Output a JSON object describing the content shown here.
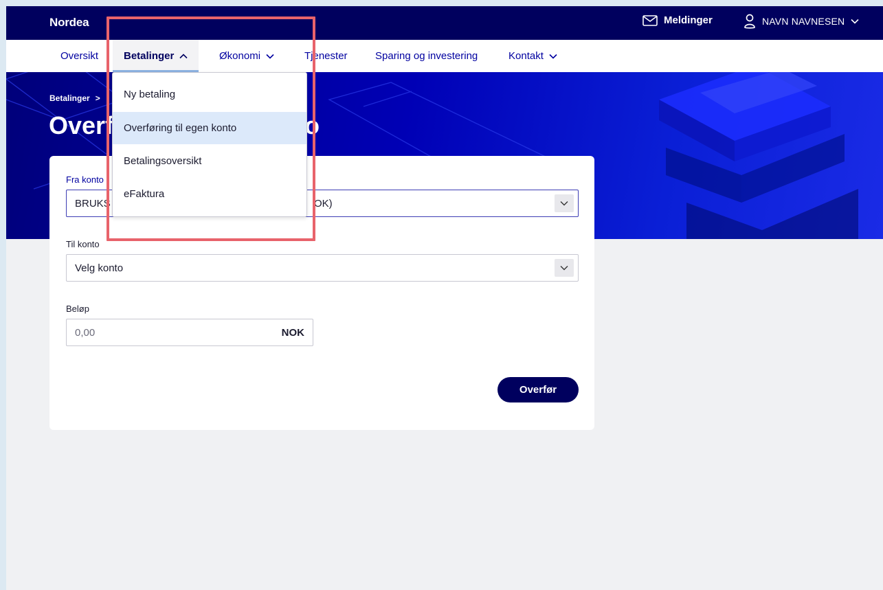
{
  "header": {
    "logo": "Nordea",
    "messages_label": "Meldinger",
    "user_name": "NAVN NAVNESEN"
  },
  "nav": {
    "items": [
      {
        "label": "Oversikt"
      },
      {
        "label": "Betalinger"
      },
      {
        "label": "Økonomi"
      },
      {
        "label": "Tjenester"
      },
      {
        "label": "Sparing og investering"
      },
      {
        "label": "Kontakt"
      }
    ]
  },
  "breadcrumb": {
    "item": "Betalinger",
    "separator": ">"
  },
  "page": {
    "title_left": "Overf",
    "title_right": "o"
  },
  "dropdown": {
    "items": [
      {
        "label": "Ny betaling"
      },
      {
        "label": "Overføring til egen konto"
      },
      {
        "label": "Betalingsoversikt"
      },
      {
        "label": "eFaktura"
      }
    ]
  },
  "form": {
    "from_label": "Fra konto",
    "from_value_left": "BRUKS",
    "from_value_right": "OK)",
    "to_label": "Til konto",
    "to_value": "Velg konto",
    "amount_label": "Beløp",
    "amount_placeholder": "0,00",
    "currency": "NOK",
    "submit_label": "Overfør"
  },
  "colors": {
    "brand": "#00005e",
    "link": "#0000a0",
    "highlight": "#e8636b",
    "selected_item": "#dce9fa"
  }
}
